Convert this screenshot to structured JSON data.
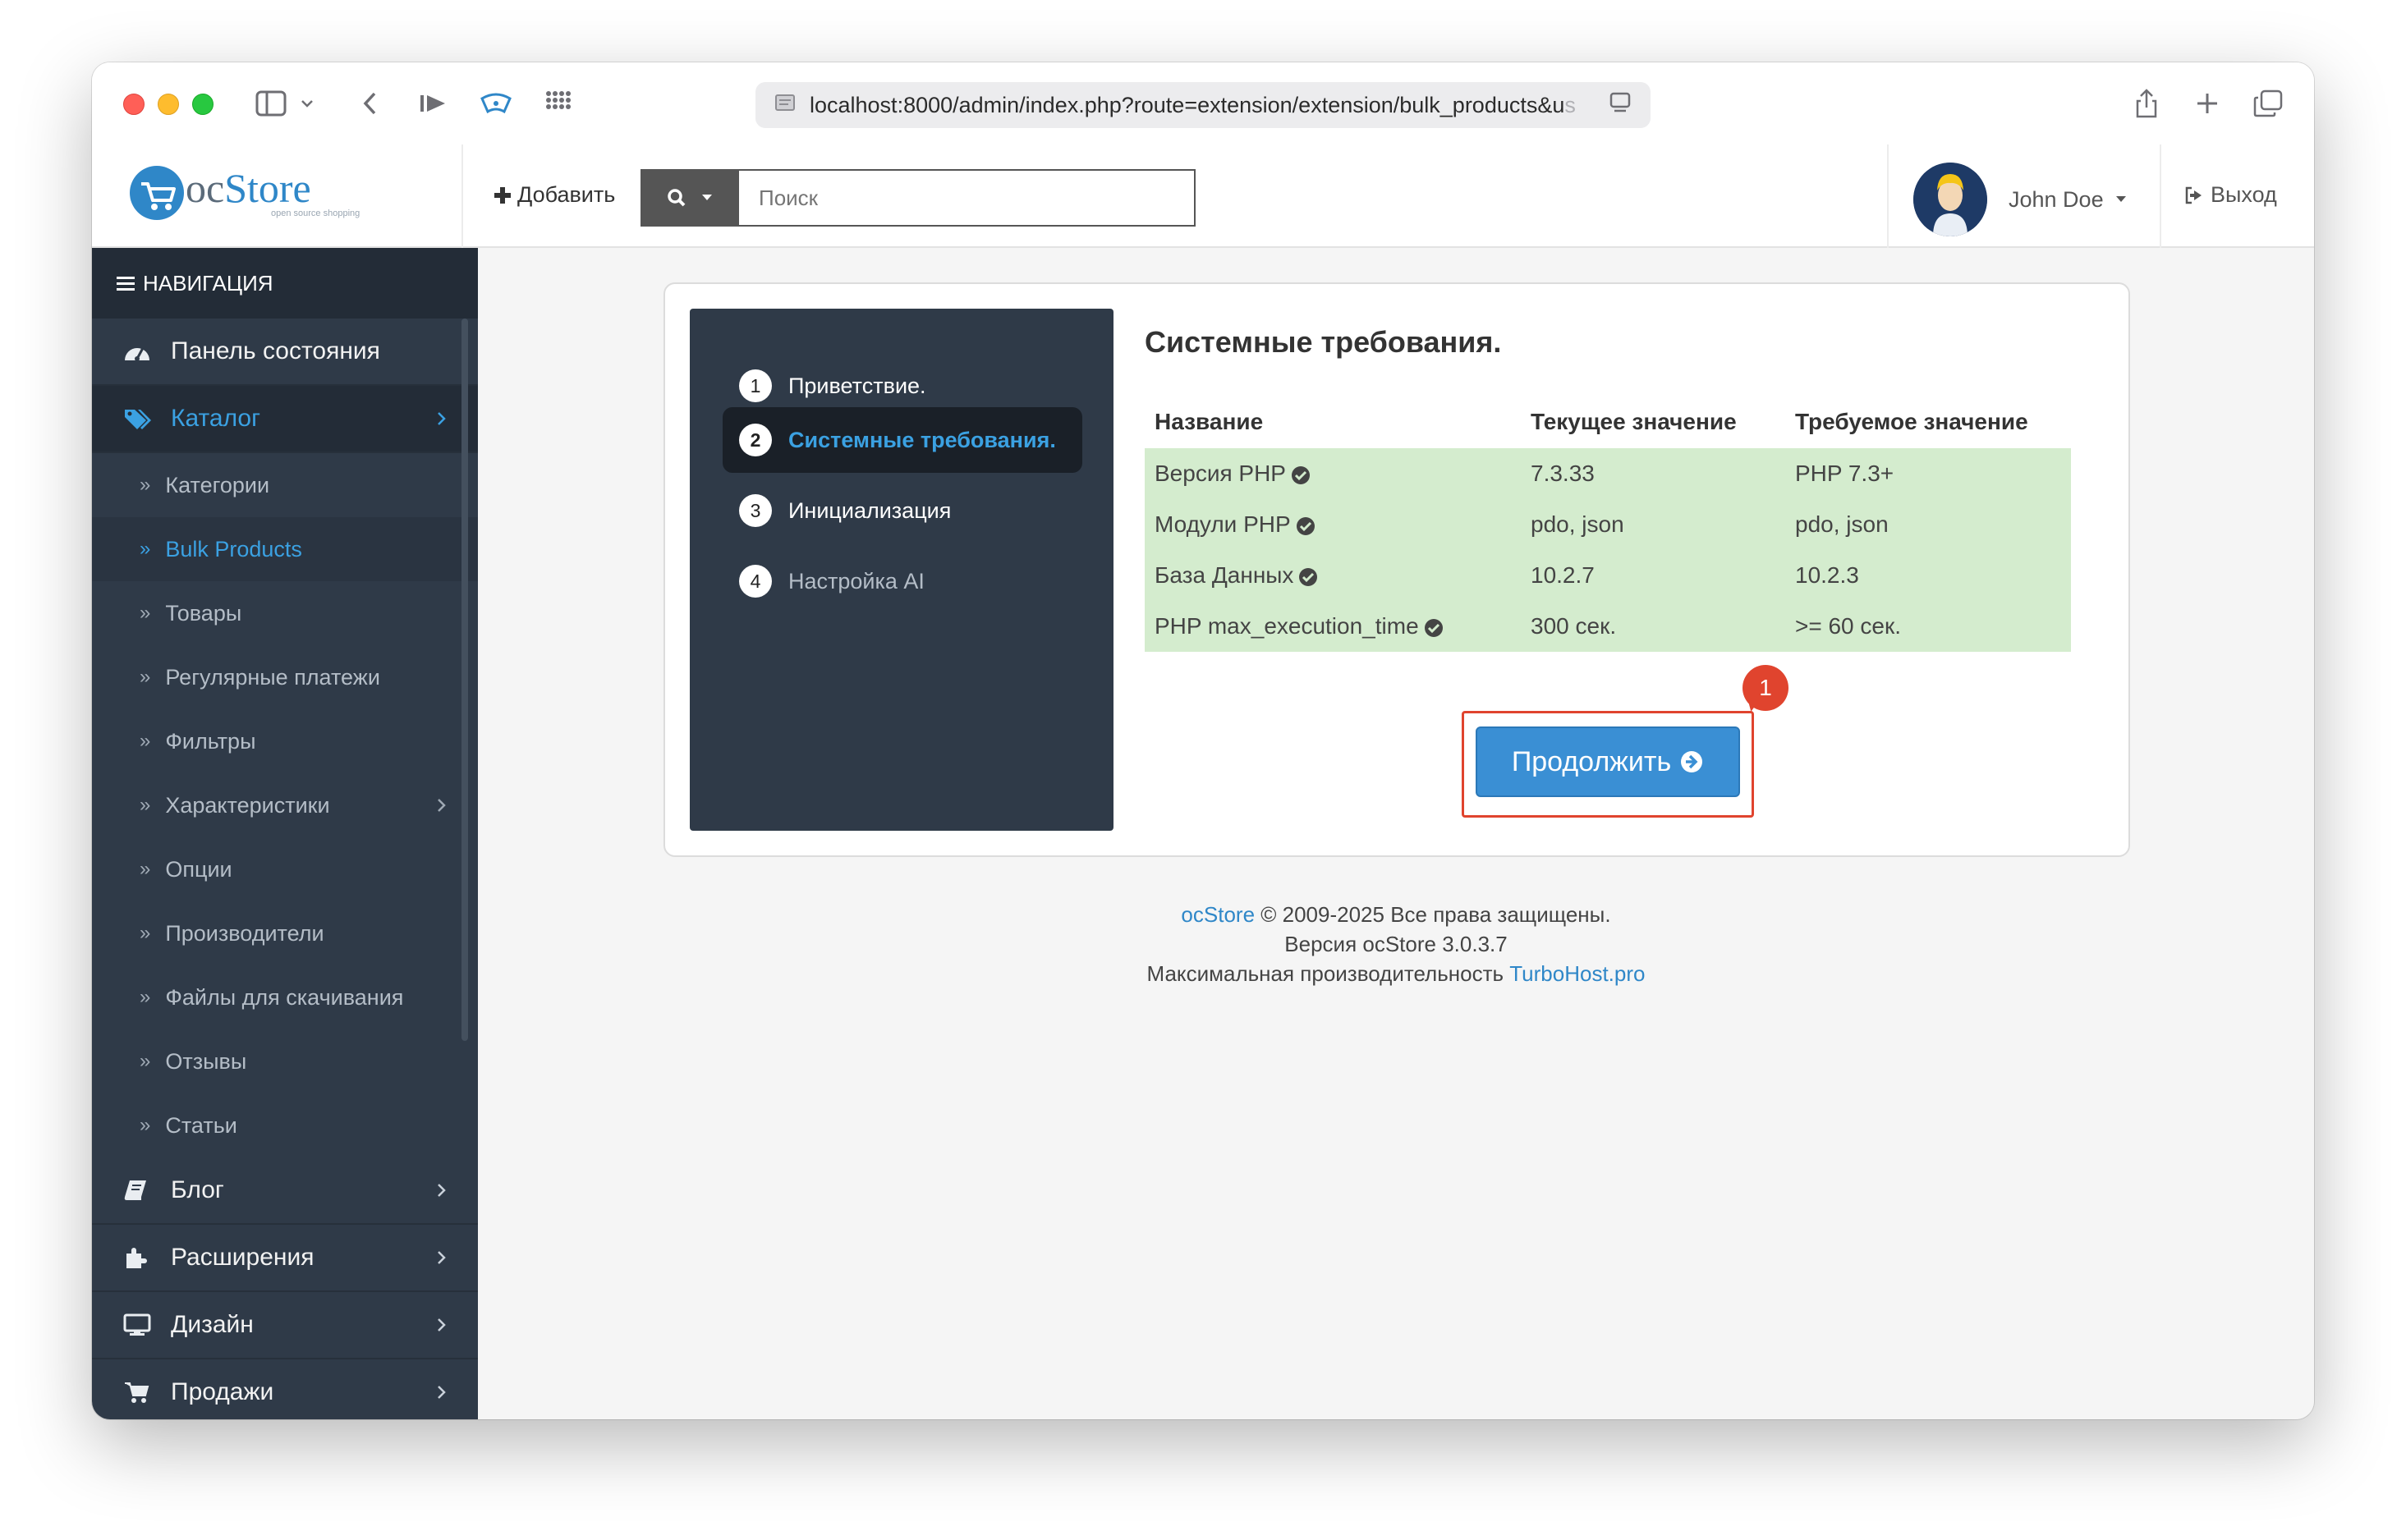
{
  "browser": {
    "url": "localhost:8000/admin/index.php?route=extension/extension/bulk_products&u",
    "url_fade": "s"
  },
  "header": {
    "logo_oc": "oc",
    "logo_store": "Store",
    "logo_sub": "open source shopping",
    "add_label": "Добавить",
    "search_placeholder": "Поиск",
    "user_name": "John Doe",
    "logout_label": "Выход"
  },
  "sidebar": {
    "nav_title": "НАВИГАЦИЯ",
    "items": [
      {
        "label": "Панель состояния",
        "icon": "dashboard-icon"
      },
      {
        "label": "Каталог",
        "icon": "tags-icon"
      },
      {
        "label": "Блог",
        "icon": "book-icon"
      },
      {
        "label": "Расширения",
        "icon": "puzzle-icon"
      },
      {
        "label": "Дизайн",
        "icon": "monitor-icon"
      },
      {
        "label": "Продажи",
        "icon": "cart-icon"
      }
    ],
    "catalog_sub": [
      "Категории",
      "Bulk Products",
      "Товары",
      "Регулярные платежи",
      "Фильтры",
      "Характеристики",
      "Опции",
      "Производители",
      "Файлы для скачивания",
      "Отзывы",
      "Статьи"
    ]
  },
  "steps": [
    {
      "num": "1",
      "label": "Приветствие."
    },
    {
      "num": "2",
      "label": "Системные требования."
    },
    {
      "num": "3",
      "label": "Инициализация"
    },
    {
      "num": "4",
      "label": "Настройка AI"
    }
  ],
  "content": {
    "title": "Системные требования.",
    "headers": [
      "Название",
      "Текущее значение",
      "Требуемое значение"
    ],
    "rows": [
      {
        "name": "Версия PHP",
        "current": "7.3.33",
        "required": "PHP 7.3+"
      },
      {
        "name": "Модули PHP",
        "current": "pdo, json",
        "required": "pdo, json"
      },
      {
        "name": "База Данных",
        "current": "10.2.7",
        "required": "10.2.3"
      },
      {
        "name": "PHP max_execution_time",
        "current": "300 сек.",
        "required": ">= 60 сек."
      }
    ],
    "continue_label": "Продолжить",
    "badge": "1"
  },
  "footer": {
    "line1_link": "ocStore",
    "line1_text": " © 2009-2025 Все права защищены.",
    "line2": "Версия ocStore 3.0.3.7",
    "line3_text": "Максимальная производительность ",
    "line3_link": "TurboHost.pro"
  },
  "colors": {
    "accent": "#3ba1e2",
    "sidebar_bg": "#2f3a48",
    "ok_row": "#d4ecce",
    "highlight": "#e0442e"
  }
}
